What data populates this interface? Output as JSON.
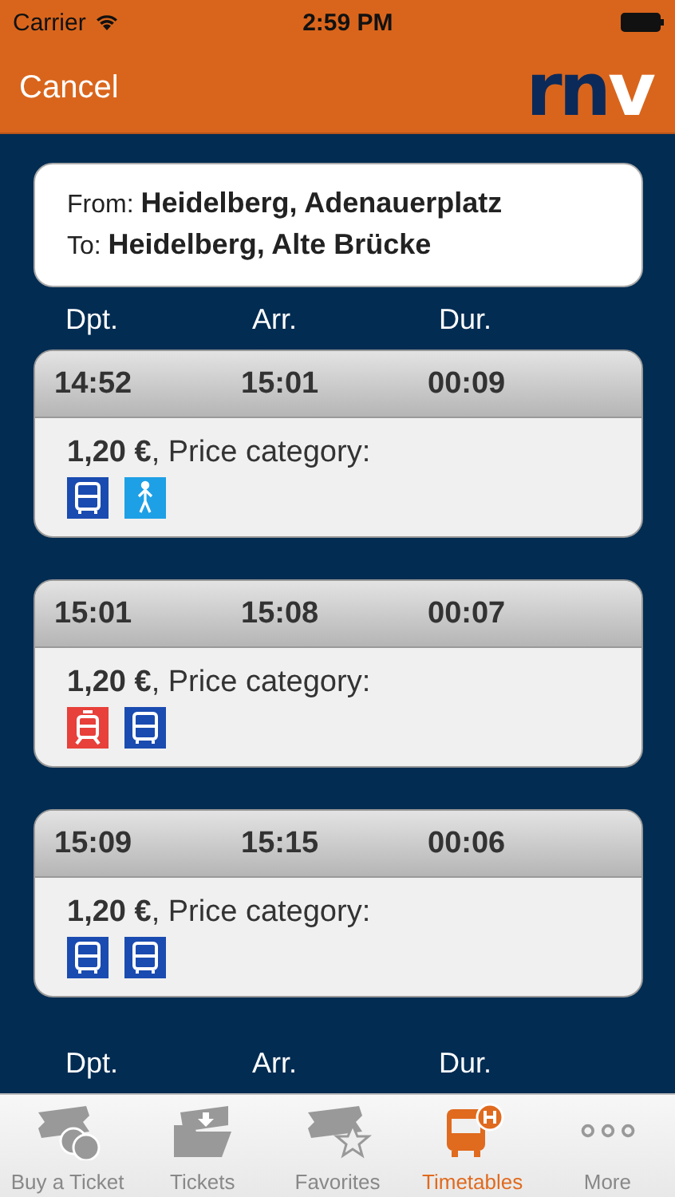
{
  "status_bar": {
    "carrier": "Carrier",
    "time": "2:59 PM"
  },
  "nav": {
    "cancel": "Cancel",
    "logo_dark": "rn",
    "logo_light": "v"
  },
  "route": {
    "from_label": "From:",
    "from": "Heidelberg, Adenauerplatz",
    "to_label": "To:",
    "to": "Heidelberg, Alte Brücke"
  },
  "columns": [
    "Dpt.",
    "Arr.",
    "Dur."
  ],
  "trips": [
    {
      "dpt": "14:52",
      "arr": "15:01",
      "dur": "00:09",
      "price": "**1,20 €**, Price category:",
      "modes": [
        {
          "kind": "bus",
          "color": "#1a4bb0"
        },
        {
          "kind": "walk",
          "color": "#1ea0e6"
        }
      ]
    },
    {
      "dpt": "15:01",
      "arr": "15:08",
      "dur": "00:07",
      "price": "**1,20 €**, Price category:",
      "modes": [
        {
          "kind": "tram",
          "color": "#e8403a"
        },
        {
          "kind": "bus",
          "color": "#1a4bb0"
        }
      ]
    },
    {
      "dpt": "15:09",
      "arr": "15:15",
      "dur": "00:06",
      "price": "**1,20 €**, Price category:",
      "modes": [
        {
          "kind": "bus",
          "color": "#1a4bb0"
        },
        {
          "kind": "bus",
          "color": "#1a4bb0"
        }
      ]
    }
  ],
  "columns_repeat": [
    "Dpt.",
    "Arr.",
    "Dur."
  ],
  "tabs": [
    {
      "label": "Buy a Ticket",
      "kind": "buy",
      "selected": false
    },
    {
      "label": "Tickets",
      "kind": "tickets",
      "selected": false
    },
    {
      "label": "Favorites",
      "kind": "favorites",
      "selected": false
    },
    {
      "label": "Timetables",
      "kind": "timetables",
      "selected": true
    },
    {
      "label": "More",
      "kind": "more",
      "selected": false
    }
  ]
}
